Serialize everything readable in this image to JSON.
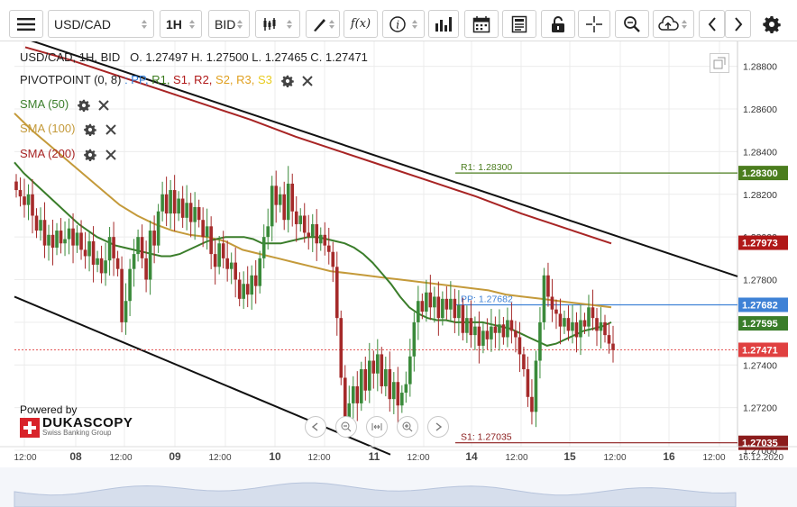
{
  "toolbar": {
    "symbol": "USD/CAD",
    "timeframe": "1H",
    "side": "BID",
    "icons": [
      "menu-icon",
      "symbol-dropdown-icon",
      "timeframe-dropdown-icon",
      "side-dropdown-icon",
      "candle-type-icon",
      "draw-icon",
      "function-icon",
      "info-icon",
      "volume-bars-icon",
      "calendar-icon",
      "news-icon",
      "lock-icon",
      "crosshair-icon",
      "zoom-icon",
      "cloud-upload-icon",
      "back-icon",
      "forward-icon",
      "settings-icon"
    ]
  },
  "legend": {
    "quote": "USD/CAD, 1H, BID",
    "ohlc": "O. 1.27497 H. 1.27500 L. 1.27465 C. 1.27471",
    "pivot_label": "PIVOTPOINT (0, 8)",
    "pivot_levels": [
      {
        "text": ": PP,",
        "color": "#2f7bd6"
      },
      {
        "text": " R1,",
        "color": "#3a7a1c"
      },
      {
        "text": " S1,",
        "color": "#b01818"
      },
      {
        "text": " R2,",
        "color": "#b01818"
      },
      {
        "text": " S2,",
        "color": "#e0a020"
      },
      {
        "text": " R3,",
        "color": "#e0a020"
      },
      {
        "text": " S3",
        "color": "#e8cc20"
      }
    ],
    "sma50": "SMA (50)",
    "sma100": "SMA (100)",
    "sma200": "SMA (200)"
  },
  "branding": {
    "powered_by": "Powered by",
    "logo": "DUKASCOPY",
    "tagline": "Swiss Banking Group"
  },
  "colors": {
    "bull": "#3a8a3a",
    "bear": "#a52a2a",
    "sma50": "#3a7d2a",
    "sma100": "#c49a3a",
    "sma200": "#a82424",
    "pp": "#3f82d6",
    "r1": "#4b7d1e",
    "s1": "#8b1c1c",
    "trend": "#111111",
    "last": "#e04040"
  },
  "chart_data": {
    "type": "candlestick",
    "symbol": "USD/CAD",
    "timeframe": "1H",
    "ylim": [
      1.27,
      1.289
    ],
    "y_ticks": [
      "1.28800",
      "1.28600",
      "1.28400",
      "1.28200",
      "1.28000",
      "1.27800",
      "1.27600",
      "1.27400",
      "1.27200",
      "1.27000"
    ],
    "x_ticks": [
      "12:00",
      "08",
      "12:00",
      "09",
      "12:00",
      "10",
      "12:00",
      "11",
      "12:00",
      "14",
      "12:00",
      "15",
      "12:00",
      "16",
      "12:00",
      "16.12.2020"
    ],
    "date_labels": [
      "08",
      "09",
      "10",
      "11",
      "14",
      "15",
      "16"
    ],
    "levels": {
      "PP": {
        "label": "PP: 1.27682",
        "value": 1.27682,
        "tag": "1.27682"
      },
      "R1": {
        "label": "R1: 1.28300",
        "value": 1.283,
        "tag": "1.28300"
      },
      "S1": {
        "label": "S1: 1.27035",
        "value": 1.27035,
        "tag": "1.27035"
      }
    },
    "tags": {
      "sma200": "1.27973",
      "sma50": "1.27595",
      "last": "1.27471"
    },
    "last_price": 1.27471,
    "ohlc": {
      "open": 1.27497,
      "high": 1.275,
      "low": 1.27465,
      "close": 1.27471
    },
    "candles_close": [
      1.2822,
      1.2819,
      1.2815,
      1.282,
      1.281,
      1.2803,
      1.2808,
      1.2796,
      1.2801,
      1.2795,
      1.2803,
      1.2797,
      1.2799,
      1.2804,
      1.2796,
      1.2802,
      1.2794,
      1.2791,
      1.2798,
      1.2787,
      1.279,
      1.2783,
      1.2789,
      1.28,
      1.279,
      1.2785,
      1.276,
      1.277,
      1.2785,
      1.2792,
      1.28,
      1.279,
      1.278,
      1.2803,
      1.2796,
      1.2812,
      1.282,
      1.2811,
      1.2822,
      1.2811,
      1.2818,
      1.2809,
      1.2816,
      1.2807,
      1.2814,
      1.2808,
      1.28,
      1.2805,
      1.2792,
      1.2786,
      1.2797,
      1.279,
      1.2785,
      1.2788,
      1.278,
      1.2771,
      1.2778,
      1.2773,
      1.2782,
      1.2777,
      1.279,
      1.28,
      1.2805,
      1.2824,
      1.2815,
      1.282,
      1.2808,
      1.2825,
      1.2812,
      1.2806,
      1.281,
      1.2802,
      1.28,
      1.2806,
      1.2797,
      1.2801,
      1.2796,
      1.2793,
      1.2786,
      1.2762,
      1.2734,
      1.2715,
      1.2722,
      1.273,
      1.2722,
      1.2738,
      1.2728,
      1.2742,
      1.2736,
      1.2745,
      1.273,
      1.2738,
      1.2724,
      1.2732,
      1.2721,
      1.2727,
      1.2731,
      1.2744,
      1.276,
      1.277,
      1.2765,
      1.2774,
      1.2767,
      1.2772,
      1.2762,
      1.2771,
      1.2766,
      1.2771,
      1.2762,
      1.2768,
      1.2755,
      1.2762,
      1.2754,
      1.2758,
      1.2749,
      1.2756,
      1.2752,
      1.2758,
      1.2755,
      1.2759,
      1.2753,
      1.2761,
      1.2756,
      1.2753,
      1.2745,
      1.2738,
      1.2725,
      1.2718,
      1.2742,
      1.276,
      1.2782,
      1.2772,
      1.2766,
      1.2764,
      1.2758,
      1.2762,
      1.2756,
      1.276,
      1.2753,
      1.2761,
      1.2758,
      1.2767,
      1.2762,
      1.2756,
      1.276,
      1.2754,
      1.275,
      1.2747
    ],
    "sma50": [
      1.2835,
      1.283,
      1.2826,
      1.2822,
      1.2818,
      1.2814,
      1.281,
      1.2806,
      1.2803,
      1.28,
      1.2798,
      1.2796,
      1.2795,
      1.2794,
      1.2793,
      1.2792,
      1.2791,
      1.2791,
      1.2792,
      1.2794,
      1.2796,
      1.2798,
      1.2799,
      1.28,
      1.28,
      1.28,
      1.2799,
      1.2797,
      1.2797,
      1.2797,
      1.2798,
      1.2799,
      1.28,
      1.28,
      1.2799,
      1.2798,
      1.2797,
      1.2795,
      1.2792,
      1.2788,
      1.2783,
      1.2778,
      1.2772,
      1.2767,
      1.2764,
      1.2762,
      1.2761,
      1.2761,
      1.276,
      1.276,
      1.276,
      1.276,
      1.2759,
      1.2758,
      1.2757,
      1.2755,
      1.2753,
      1.2751,
      1.2749,
      1.275,
      1.2752,
      1.2754,
      1.2756,
      1.2757,
      1.2758,
      1.276
    ],
    "sma100": [
      1.2858,
      1.285,
      1.2843,
      1.2836,
      1.2829,
      1.2822,
      1.2815,
      1.281,
      1.2806,
      1.2803,
      1.2801,
      1.28,
      1.2798,
      1.2794,
      1.2792,
      1.279,
      1.2788,
      1.2786,
      1.2784,
      1.2783,
      1.2782,
      1.2781,
      1.278,
      1.2779,
      1.2778,
      1.2777,
      1.2776,
      1.2775,
      1.2773,
      1.2772,
      1.2771,
      1.277,
      1.2769,
      1.2768,
      1.2767
    ],
    "sma200": [
      1.2889,
      1.2883,
      1.2876,
      1.2869,
      1.2862,
      1.2855,
      1.2847,
      1.284,
      1.2833,
      1.2826,
      1.2819,
      1.2811,
      1.2804,
      1.2797
    ],
    "trendlines": [
      {
        "from": [
          "12:00 07",
          1.289
        ],
        "to": [
          "15 12:00",
          1.278
        ]
      },
      {
        "from": [
          "12:00 07",
          1.2771
        ],
        "to": [
          "11 00:00",
          1.2698
        ]
      }
    ]
  }
}
